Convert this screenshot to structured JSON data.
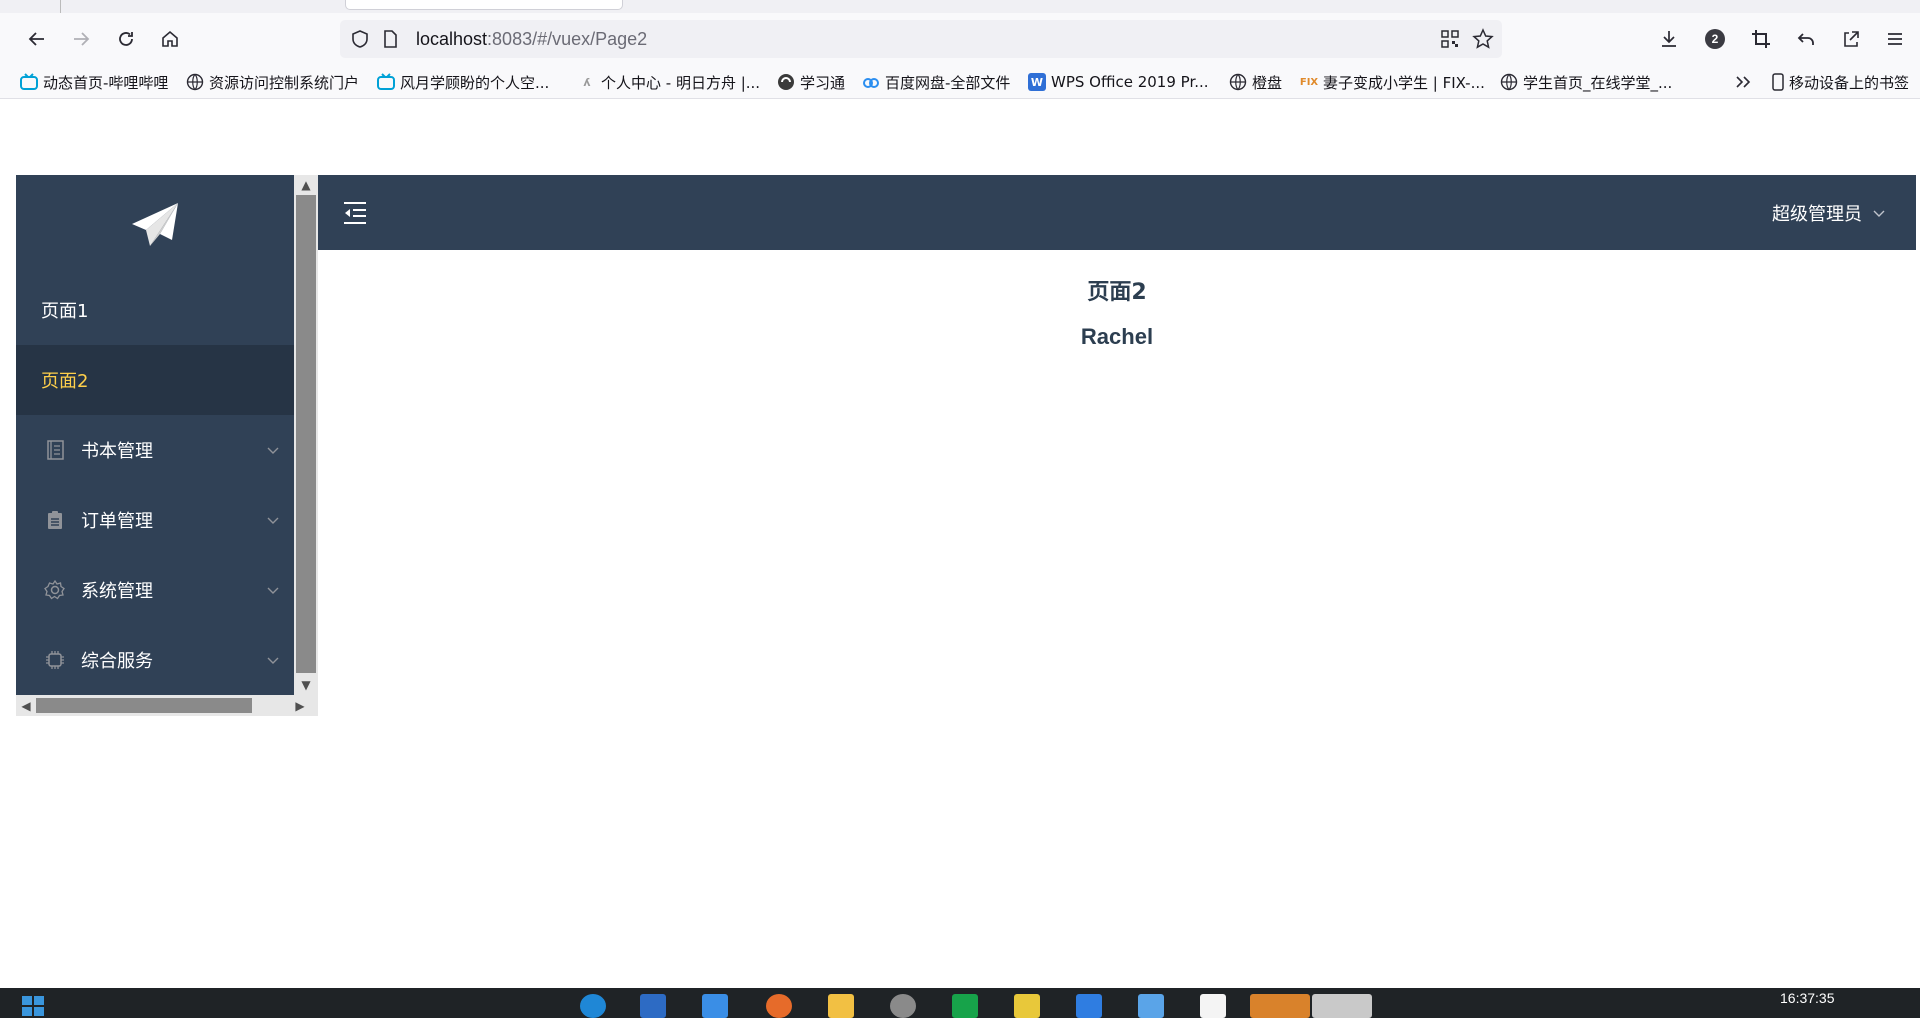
{
  "browser": {
    "url_host": "localhost",
    "url_rest": ":8083/#/vuex/Page2",
    "extension_badge": "2",
    "bookmarks": [
      {
        "label": "动态首页-哔哩哔哩",
        "icon": "bilibili-icon"
      },
      {
        "label": "资源访问控制系统门户",
        "icon": "globe-icon"
      },
      {
        "label": "风月学顾盼的个人空...",
        "icon": "bilibili-icon"
      },
      {
        "label": "个人中心 - 明日方舟 |...",
        "icon": "arknights-icon"
      },
      {
        "label": "学习通",
        "icon": "chaoxing-icon"
      },
      {
        "label": "百度网盘-全部文件",
        "icon": "baidu-netdisk-icon"
      },
      {
        "label": "WPS Office 2019 Pr...",
        "icon": "wps-icon"
      },
      {
        "label": "橙盘",
        "icon": "globe-icon"
      },
      {
        "label": "妻子变成小学生 | FIX-...",
        "icon": "fix-icon"
      },
      {
        "label": "学生首页_在线学堂_...",
        "icon": "globe-icon"
      }
    ],
    "mobile_bookmarks": "移动设备上的书签"
  },
  "sidebar": {
    "items": [
      {
        "label": "页面1",
        "active": false
      },
      {
        "label": "页面2",
        "active": true
      },
      {
        "label": "书本管理",
        "icon": "book-icon",
        "submenu": true
      },
      {
        "label": "订单管理",
        "icon": "clipboard-icon",
        "submenu": true
      },
      {
        "label": "系统管理",
        "icon": "gear-icon",
        "submenu": true
      },
      {
        "label": "综合服务",
        "icon": "chip-icon",
        "submenu": true
      }
    ]
  },
  "header": {
    "user": "超级管理员"
  },
  "content": {
    "title": "页面2",
    "name": "Rachel"
  },
  "taskbar": {
    "clock": "16:37:35"
  },
  "colors": {
    "sidebar_bg": "#304156",
    "active_bg": "#263445",
    "active_text": "#ffd04b"
  }
}
